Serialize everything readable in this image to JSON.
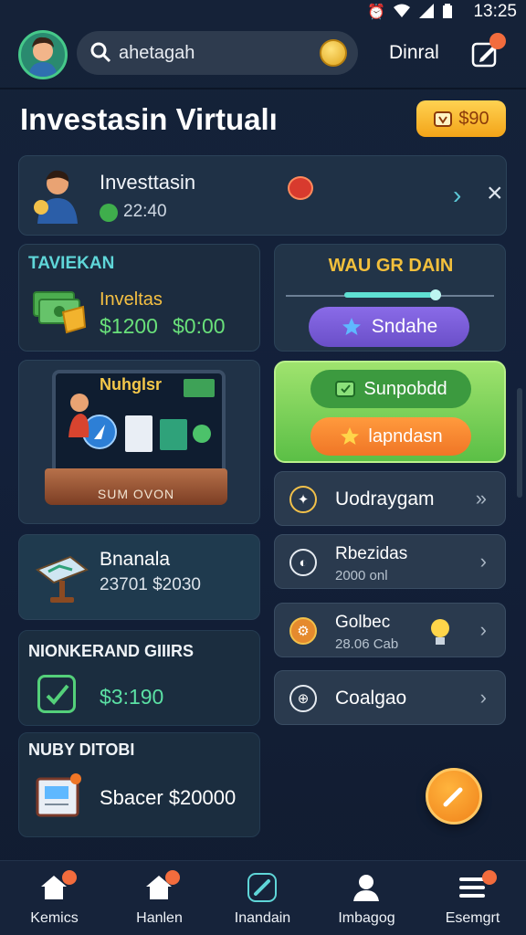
{
  "status_bar": {
    "time": "13:25"
  },
  "header": {
    "search_value": "ahetagah",
    "top_link": "Dinral"
  },
  "title_row": {
    "title": "Investasin Virtualı",
    "balance": "$90"
  },
  "notification": {
    "title": "Investtasin",
    "time": "22:40"
  },
  "invest_card": {
    "label": "TAVIEKAN",
    "name": "Inveltas",
    "amount": "$1200",
    "amount2": "$0:00"
  },
  "wager_card": {
    "title": "WAU GR DAIN",
    "button_label": "Sndahe",
    "progress": 0.45
  },
  "laptop_card": {
    "title": "Nuhglsr",
    "caption": "SUM OVON"
  },
  "action_buttons": {
    "green_label": "Sunpobdd",
    "orange_label": "Ɩapndasn"
  },
  "menu": {
    "items": [
      {
        "label": "Uodraygam"
      },
      {
        "label": "Rbezidas",
        "sub": "2000 onl"
      },
      {
        "label": "Golbec",
        "sub": "28.06 Cab"
      },
      {
        "label": "Coalgao"
      }
    ]
  },
  "banana_card": {
    "title": "Bnanala",
    "sub": "23701 $2030"
  },
  "nonker_card": {
    "label": "NIONKERAND GIIIRS",
    "value": "$3:190"
  },
  "nuby_card": {
    "label": "NUBY DITOBI",
    "value": "Sbacer $20000"
  },
  "bottom_nav": {
    "items": [
      {
        "label": "Kemics"
      },
      {
        "label": "Hanlen"
      },
      {
        "label": "Inandain"
      },
      {
        "label": "Imbagog"
      },
      {
        "label": "Esemgrt"
      }
    ]
  },
  "colors": {
    "background": "#152238",
    "accent_gold": "#f3a418",
    "accent_green": "#5bbf46",
    "accent_orange": "#f07626",
    "accent_purple": "#6a4fc8",
    "badge": "#f26c3d"
  }
}
